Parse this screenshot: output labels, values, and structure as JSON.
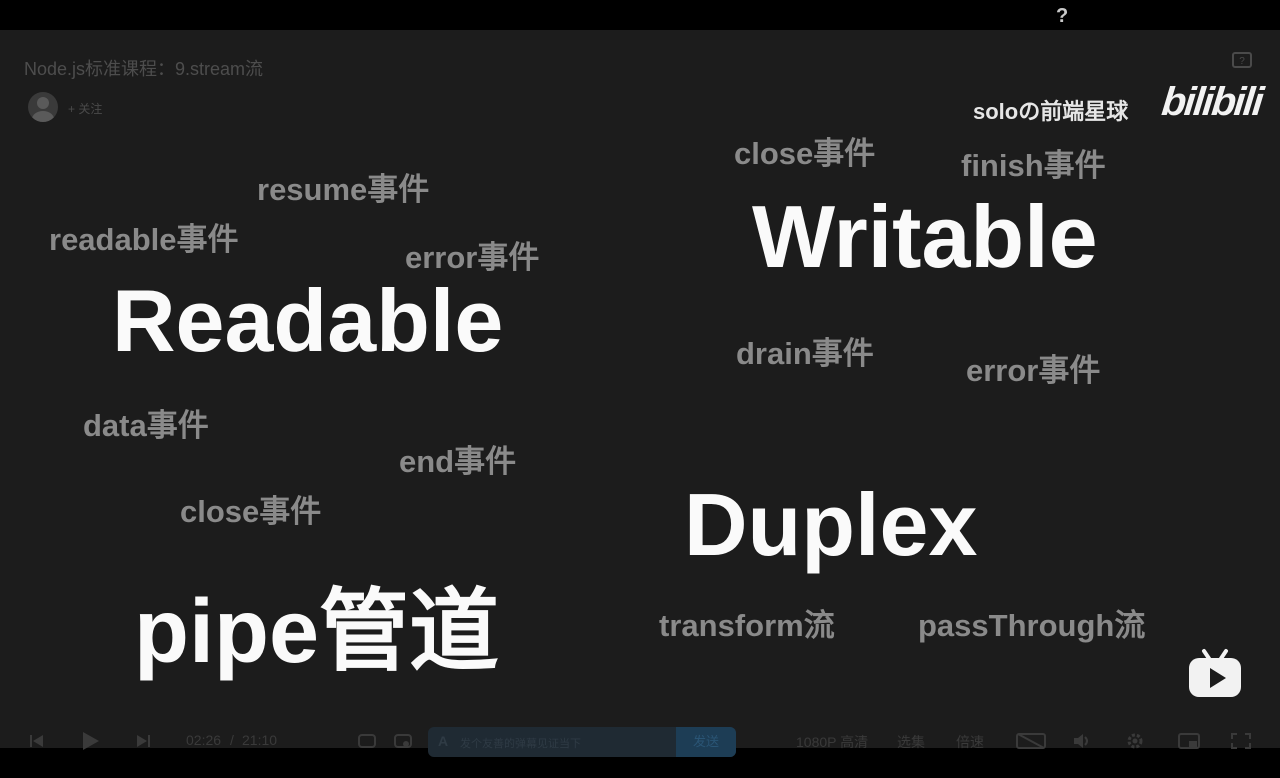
{
  "top_bar": {
    "help_label": "?"
  },
  "player": {
    "title": "Node.js标准课程：9.stream流",
    "follow_label": "+ 关注",
    "watermark": {
      "author": "soloの前端星球",
      "brand": "bilibili"
    }
  },
  "slide": {
    "readable": {
      "heading": "Readable",
      "events": {
        "resume": "resume事件",
        "readable": "readable事件",
        "error": "error事件",
        "data": "data事件",
        "end": "end事件",
        "close": "close事件"
      }
    },
    "writable": {
      "heading": "Writable",
      "events": {
        "close": "close事件",
        "finish": "finish事件",
        "drain": "drain事件",
        "error": "error事件"
      }
    },
    "duplex": {
      "heading": "Duplex",
      "variants": {
        "transform": "transform流",
        "pass_through": "passThrough流"
      }
    },
    "pipe": {
      "heading": "pipe管道"
    }
  },
  "controls": {
    "current_time": "02:26",
    "separator": "/",
    "duration": "21:10",
    "danmaku_placeholder": "发个友善的弹幕见证当下",
    "send_label": "发送",
    "quality": "1080P 高清",
    "episodes": "选集",
    "speed": "倍速"
  },
  "icons": {
    "help": "question-mark-icon",
    "tv": "bilibili-tv-icon",
    "prev": "skip-previous-icon",
    "play": "play-icon",
    "next": "skip-next-icon",
    "volume": "volume-icon",
    "settings": "gear-icon",
    "pip": "picture-in-picture-icon",
    "fullscreen": "fullscreen-icon"
  },
  "colors": {
    "background": "#1c1c1c",
    "heading": "#fafafa",
    "event_text": "#8a8a8a"
  }
}
